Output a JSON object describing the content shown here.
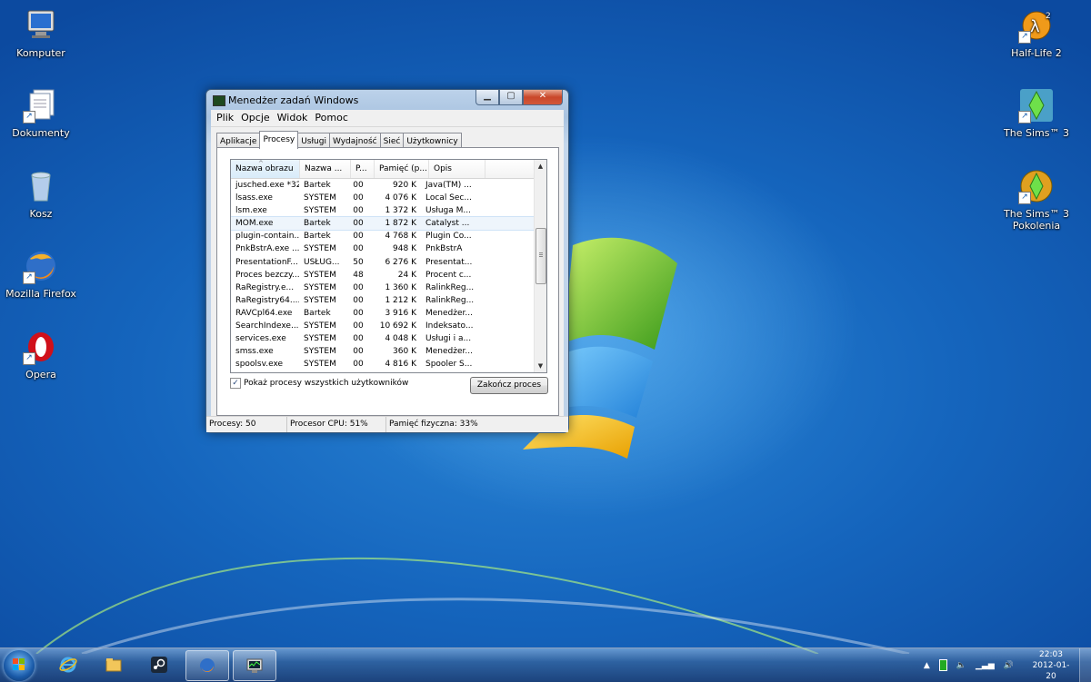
{
  "desktop_icons_left": [
    {
      "label": "Komputer",
      "icon": "computer-icon"
    },
    {
      "label": "Dokumenty",
      "icon": "documents-icon"
    },
    {
      "label": "Kosz",
      "icon": "recycle-bin-icon"
    },
    {
      "label": "Mozilla Firefox",
      "icon": "firefox-icon"
    },
    {
      "label": "Opera",
      "icon": "opera-icon"
    }
  ],
  "desktop_icons_right": [
    {
      "label": "Half-Life 2",
      "icon": "half-life-2-icon"
    },
    {
      "label": "The Sims™ 3",
      "icon": "sims3-icon"
    },
    {
      "label": "The Sims™ 3 Pokolenia",
      "icon": "sims3-generations-icon"
    }
  ],
  "window": {
    "title": "Menedżer zadań Windows",
    "menu": [
      "Plik",
      "Opcje",
      "Widok",
      "Pomoc"
    ],
    "tabs": [
      "Aplikacje",
      "Procesy",
      "Usługi",
      "Wydajność",
      "Sieć",
      "Użytkownicy"
    ],
    "active_tab": "Procesy",
    "columns": [
      "Nazwa obrazu",
      "Nazwa ...",
      "P...",
      "Pamięć (p...",
      "Opis"
    ],
    "rows": [
      [
        "jusched.exe *32",
        "Bartek",
        "00",
        "920 K",
        "Java(TM) ..."
      ],
      [
        "lsass.exe",
        "SYSTEM",
        "00",
        "4 076 K",
        "Local Sec..."
      ],
      [
        "lsm.exe",
        "SYSTEM",
        "00",
        "1 372 K",
        "Usługa M..."
      ],
      [
        "MOM.exe",
        "Bartek",
        "00",
        "1 872 K",
        "Catalyst ..."
      ],
      [
        "plugin-contain...",
        "Bartek",
        "00",
        "4 768 K",
        "Plugin Co..."
      ],
      [
        "PnkBstrA.exe ...",
        "SYSTEM",
        "00",
        "948 K",
        "PnkBstrA"
      ],
      [
        "PresentationF...",
        "USŁUG...",
        "50",
        "6 276 K",
        "Presentat..."
      ],
      [
        "Proces bezczy...",
        "SYSTEM",
        "48",
        "24 K",
        "Procent c..."
      ],
      [
        "RaRegistry.e...",
        "SYSTEM",
        "00",
        "1 360 K",
        "RalinkReg..."
      ],
      [
        "RaRegistry64....",
        "SYSTEM",
        "00",
        "1 212 K",
        "RalinkReg..."
      ],
      [
        "RAVCpl64.exe",
        "Bartek",
        "00",
        "3 916 K",
        "Menedżer..."
      ],
      [
        "SearchIndexe...",
        "SYSTEM",
        "00",
        "10 692 K",
        "Indeksato..."
      ],
      [
        "services.exe",
        "SYSTEM",
        "00",
        "4 048 K",
        "Usługi i a..."
      ],
      [
        "smss.exe",
        "SYSTEM",
        "00",
        "360 K",
        "Menedżer..."
      ],
      [
        "spoolsv.exe",
        "SYSTEM",
        "00",
        "4 816 K",
        "Spooler S..."
      ]
    ],
    "selected_row": 3,
    "show_all_label": "Pokaż procesy wszystkich użytkowników",
    "show_all_checked": true,
    "end_process_label": "Zakończ proces",
    "status": {
      "processes": "Procesy: 50",
      "cpu": "Procesor CPU: 51%",
      "memory": "Pamięć fizyczna: 33%"
    }
  },
  "taskbar": {
    "pinned": [
      "internet-explorer-icon",
      "explorer-icon",
      "steam-icon",
      "firefox-icon",
      "task-manager-icon"
    ],
    "clock_time": "22:03",
    "clock_date": "2012-01-20"
  }
}
